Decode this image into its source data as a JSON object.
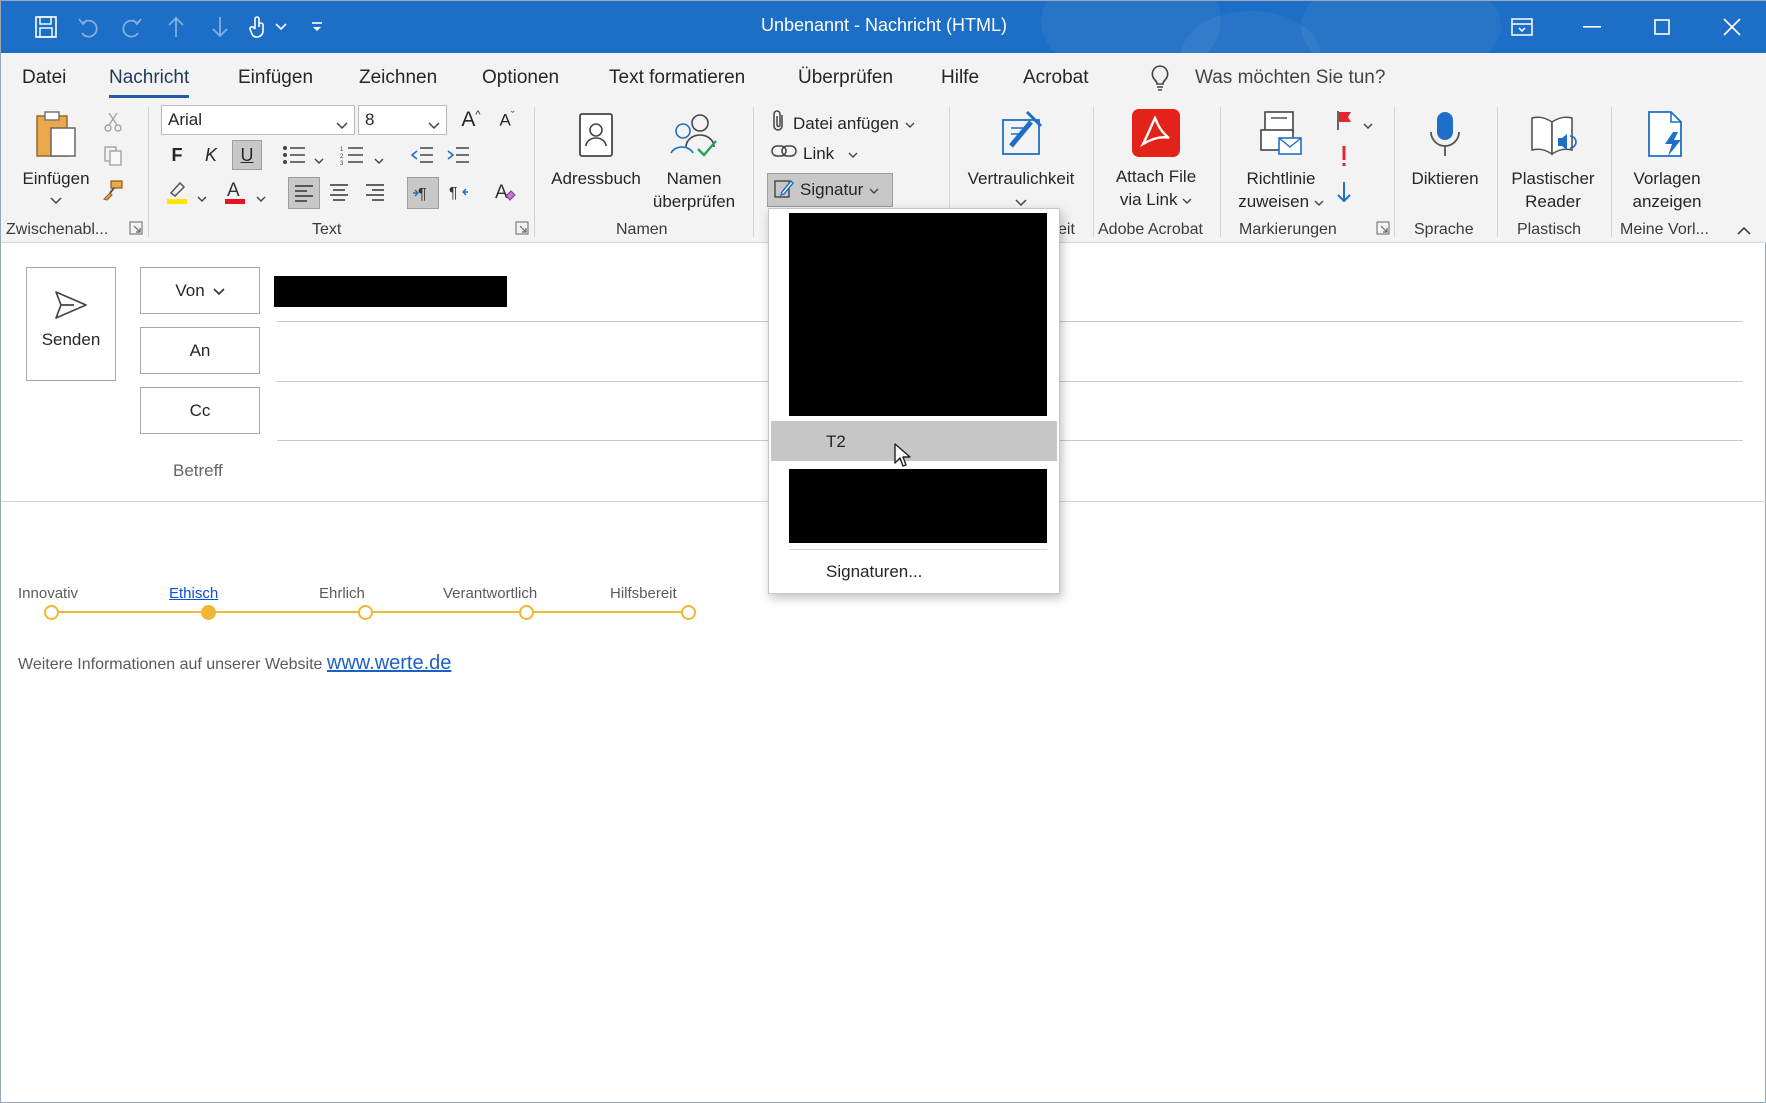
{
  "window": {
    "title": "Unbenannt  -  Nachricht (HTML)"
  },
  "tabs": [
    {
      "label": "Datei"
    },
    {
      "label": "Nachricht"
    },
    {
      "label": "Einfügen"
    },
    {
      "label": "Zeichnen"
    },
    {
      "label": "Optionen"
    },
    {
      "label": "Text formatieren"
    },
    {
      "label": "Überprüfen"
    },
    {
      "label": "Hilfe"
    },
    {
      "label": "Acrobat"
    }
  ],
  "active_tab": "Nachricht",
  "tellme": {
    "placeholder": "Was möchten Sie tun?"
  },
  "ribbon": {
    "clipboard": {
      "paste": "Einfügen",
      "group": "Zwischenabl..."
    },
    "text": {
      "font": "Arial",
      "size": "8",
      "bold": "F",
      "italic": "K",
      "underline": "U",
      "group": "Text"
    },
    "names": {
      "addressbook": "Adressbuch",
      "check_names_1": "Namen",
      "check_names_2": "überprüfen",
      "group": "Namen"
    },
    "include": {
      "attach": "Datei anfügen",
      "link": "Link",
      "signature": "Signatur"
    },
    "sensitivity": {
      "label": "Vertraulichkeit",
      "group_tail": "eit"
    },
    "acrobat": {
      "attach_1": "Attach File",
      "attach_2": "via Link",
      "group": "Adobe Acrobat"
    },
    "tags": {
      "policy_1": "Richtlinie",
      "policy_2": "zuweisen",
      "group": "Markierungen"
    },
    "voice": {
      "dictate": "Diktieren",
      "group": "Sprache"
    },
    "immersive": {
      "reader_1": "Plastischer",
      "reader_2": "Reader",
      "group": "Plastisch"
    },
    "templates": {
      "view_1": "Vorlagen",
      "view_2": "anzeigen",
      "group": "Meine Vorl..."
    }
  },
  "compose": {
    "send": "Senden",
    "from": "Von",
    "to": "An",
    "cc": "Cc",
    "subject": "Betreff"
  },
  "signature_menu": {
    "item_t2": "T2",
    "manage": "Signaturen..."
  },
  "body": {
    "values": [
      {
        "label": "Innovativ",
        "highlight": false
      },
      {
        "label": "Ethisch",
        "highlight": true
      },
      {
        "label": "Ehrlich",
        "highlight": false
      },
      {
        "label": "Verantwortlich",
        "highlight": false
      },
      {
        "label": "Hilfsbereit",
        "highlight": false
      }
    ],
    "info_text": "Weitere Informationen auf unserer Website ",
    "info_link": "www.werte.de"
  },
  "colors": {
    "titlebar": "#1d6ec6",
    "accent_tab": "#1e5ea8",
    "timeline": "#f0b733",
    "link": "#1b62c6"
  }
}
